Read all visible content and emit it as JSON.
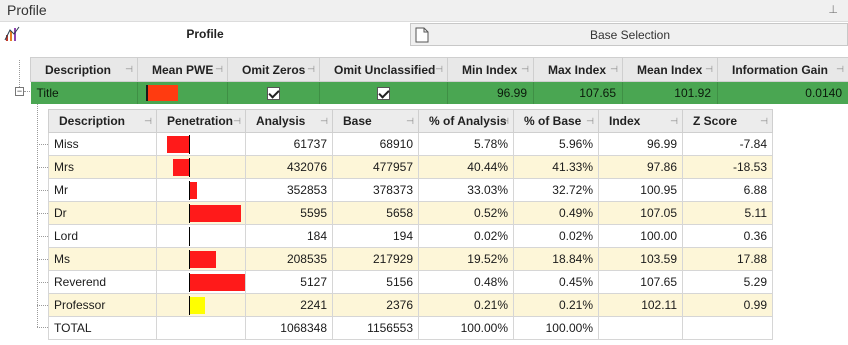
{
  "window": {
    "title": "Profile",
    "pin_glyph": "⊥"
  },
  "tabs": [
    {
      "label": "Profile",
      "icon": "profile-chart-icon"
    },
    {
      "label": "Base Selection",
      "icon": "document-icon"
    }
  ],
  "outer": {
    "headers": [
      "Description",
      "Mean PWE",
      "Omit Zeros",
      "Omit Unclassified",
      "Min Index",
      "Max Index",
      "Mean Index",
      "Information Gain"
    ],
    "row": {
      "description": "Title",
      "omit_zeros": true,
      "omit_unclassified": true,
      "min_index": "96.99",
      "max_index": "107.65",
      "mean_index": "101.92",
      "information_gain": "0.0140"
    },
    "expander_glyph": "−"
  },
  "inner": {
    "headers": [
      "Description",
      "Penetration",
      "Analysis",
      "Base",
      "% of Analysis",
      "% of Base",
      "Index",
      "Z Score"
    ],
    "rows": [
      {
        "description": "Miss",
        "penetration": -3.01,
        "analysis": "61737",
        "base": "68910",
        "pct_analysis": "5.78%",
        "pct_base": "5.96%",
        "index": "96.99",
        "z_score": "-7.84"
      },
      {
        "description": "Mrs",
        "penetration": -2.14,
        "analysis": "432076",
        "base": "477957",
        "pct_analysis": "40.44%",
        "pct_base": "41.33%",
        "index": "97.86",
        "z_score": "-18.53"
      },
      {
        "description": "Mr",
        "penetration": 0.95,
        "analysis": "352853",
        "base": "378373",
        "pct_analysis": "33.03%",
        "pct_base": "32.72%",
        "index": "100.95",
        "z_score": "6.88"
      },
      {
        "description": "Dr",
        "penetration": 7.05,
        "analysis": "5595",
        "base": "5658",
        "pct_analysis": "0.52%",
        "pct_base": "0.49%",
        "index": "107.05",
        "z_score": "5.11"
      },
      {
        "description": "Lord",
        "penetration": 0.0,
        "analysis": "184",
        "base": "194",
        "pct_analysis": "0.02%",
        "pct_base": "0.02%",
        "index": "100.00",
        "z_score": "0.36"
      },
      {
        "description": "Ms",
        "penetration": 3.59,
        "analysis": "208535",
        "base": "217929",
        "pct_analysis": "19.52%",
        "pct_base": "18.84%",
        "index": "103.59",
        "z_score": "17.88"
      },
      {
        "description": "Reverend",
        "penetration": 7.65,
        "analysis": "5127",
        "base": "5156",
        "pct_analysis": "0.48%",
        "pct_base": "0.45%",
        "index": "107.65",
        "z_score": "5.29"
      },
      {
        "description": "Professor",
        "penetration": 2.11,
        "analysis": "2241",
        "base": "2376",
        "pct_analysis": "0.21%",
        "pct_base": "0.21%",
        "index": "102.11",
        "z_score": "0.99"
      }
    ],
    "total": {
      "description": "TOTAL",
      "analysis": "1068348",
      "base": "1156553",
      "pct_analysis": "100.00%",
      "pct_base": "100.00%"
    }
  },
  "colors": {
    "row_highlight": "#4aa652",
    "bar_red": "#ff1a1a",
    "bar_yellow": "#ffff00",
    "alt_row": "#fdf6d8"
  }
}
